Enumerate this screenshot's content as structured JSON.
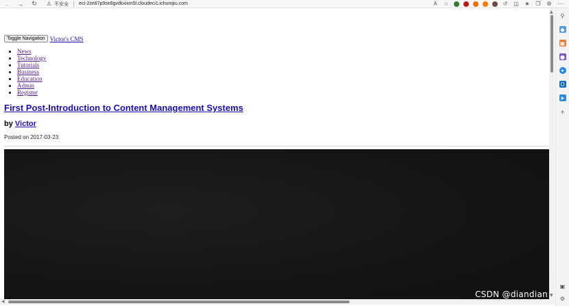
{
  "browser": {
    "insecure_label": "不安全",
    "url": "eci-2ze87p9se8gvdkxixm5l.cloudeci1.ichunqiu.com",
    "icons": {
      "back": "back-arrow-icon",
      "forward": "forward-arrow-icon",
      "refresh": "refresh-icon",
      "warning": "warning-icon",
      "read_aloud": "read-aloud-icon",
      "favorite": "star-icon"
    }
  },
  "site": {
    "toggle_label": "Toggle Navigation",
    "brand": "Victor's CMS",
    "menu": [
      "News",
      "Technology",
      "Tutorials",
      "Business",
      "Education",
      "Admin",
      "Register"
    ]
  },
  "post": {
    "title": "First Post-Introduction to Content Management Systems",
    "by_label": "by",
    "author": "Victor",
    "posted_label": "Posted on",
    "date": "2017-03-23"
  },
  "watermark": "CSDN @diandian",
  "colors": {
    "link": "#1a0dab",
    "visited": "#551a8b",
    "image_bg": "#141414"
  }
}
